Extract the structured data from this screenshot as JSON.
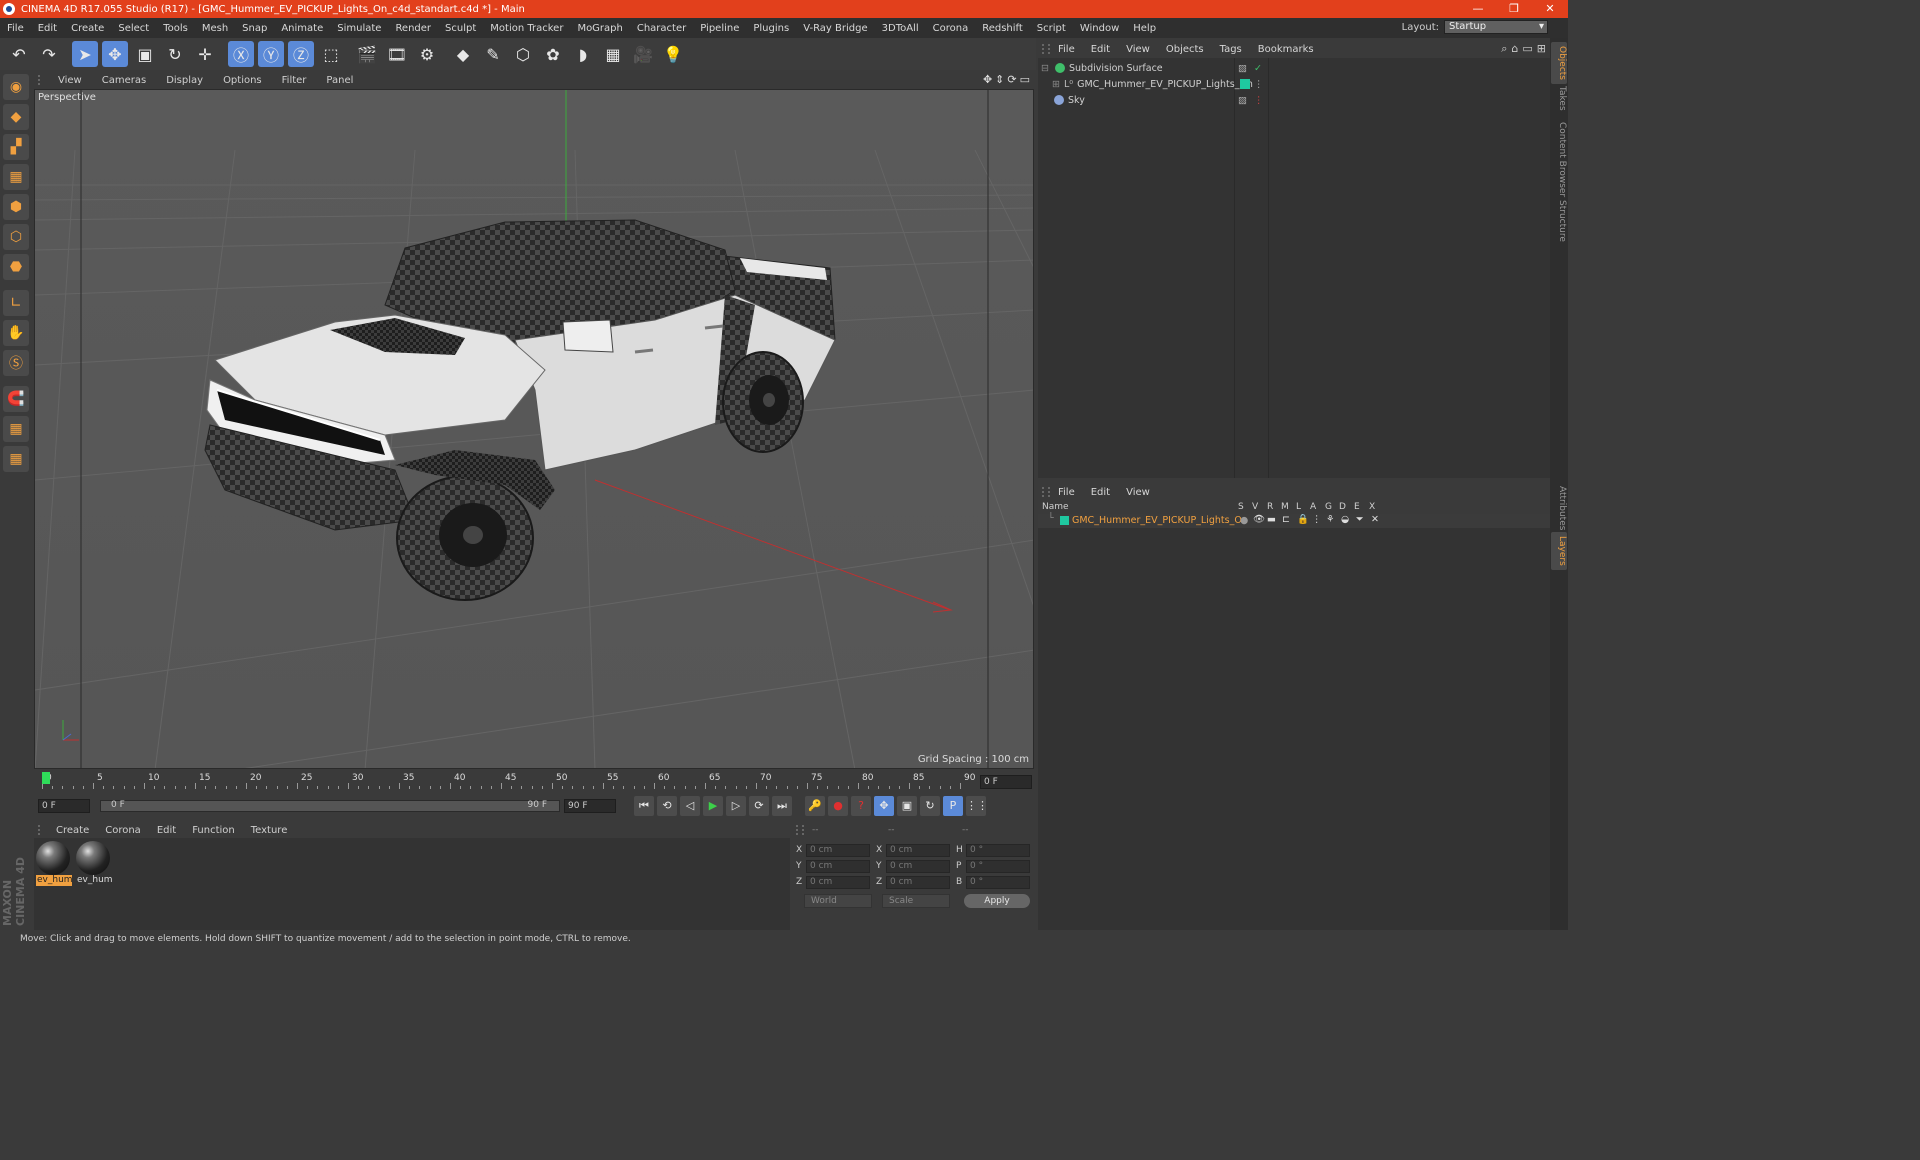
{
  "window": {
    "title": "CINEMA 4D R17.055 Studio (R17) - [GMC_Hummer_EV_PICKUP_Lights_On_c4d_standart.c4d *] - Main",
    "controls": [
      "—",
      "❐",
      "✕"
    ]
  },
  "menubar": {
    "items": [
      "File",
      "Edit",
      "Create",
      "Select",
      "Tools",
      "Mesh",
      "Snap",
      "Animate",
      "Simulate",
      "Render",
      "Sculpt",
      "Motion Tracker",
      "MoGraph",
      "Character",
      "Pipeline",
      "Plugins",
      "V-Ray Bridge",
      "3DToAll",
      "Corona",
      "Redshift",
      "Script",
      "Window",
      "Help"
    ],
    "layout_label": "Layout:",
    "layout_value": "Startup"
  },
  "toolbar": {
    "buttons": [
      {
        "name": "undo-icon",
        "glyph": "↶"
      },
      {
        "name": "redo-icon",
        "glyph": "↷"
      },
      {
        "name": "live-select-icon",
        "glyph": "➤",
        "selected": true
      },
      {
        "name": "move-icon",
        "glyph": "✥",
        "selected": true
      },
      {
        "name": "scale-icon",
        "glyph": "▣"
      },
      {
        "name": "rotate-icon",
        "glyph": "↻"
      },
      {
        "name": "transform-icon",
        "glyph": "✛"
      },
      {
        "name": "x-axis-icon",
        "glyph": "Ⓧ",
        "selected": true
      },
      {
        "name": "y-axis-icon",
        "glyph": "Ⓨ",
        "selected": true
      },
      {
        "name": "z-axis-icon",
        "glyph": "Ⓩ",
        "selected": true
      },
      {
        "name": "world-coord-icon",
        "glyph": "⬚"
      },
      {
        "name": "render-view-icon",
        "glyph": "🎬"
      },
      {
        "name": "render-picture-viewer-icon",
        "glyph": "🎞"
      },
      {
        "name": "render-settings-icon",
        "glyph": "⚙"
      },
      {
        "name": "cube-icon",
        "glyph": "◆"
      },
      {
        "name": "pen-spline-icon",
        "glyph": "✎"
      },
      {
        "name": "subdivision-icon",
        "glyph": "⬡"
      },
      {
        "name": "mograph-cloner-icon",
        "glyph": "✿"
      },
      {
        "name": "deformer-icon",
        "glyph": "◗"
      },
      {
        "name": "floor-icon",
        "glyph": "▦"
      },
      {
        "name": "camera-icon",
        "glyph": "🎥"
      },
      {
        "name": "light-icon",
        "glyph": "💡"
      }
    ]
  },
  "lefttools": {
    "buttons": [
      "make-editable-icon",
      "model-mode-icon",
      "texture-mode-icon",
      "workplane-icon",
      "points-mode-icon",
      "edges-mode-icon",
      "polygons-mode-icon",
      "axis-mode-icon",
      "tweak-mode-icon",
      "solo-icon",
      "magnet-icon",
      "snap-grid-icon",
      "snap-settings-icon"
    ],
    "glyphs": [
      "◉",
      "◆",
      "▞",
      "▦",
      "⬢",
      "⬡",
      "⬣",
      "∟",
      "✋",
      "Ⓢ",
      "🧲",
      "▦",
      "▦"
    ]
  },
  "branding": "MAXON CINEMA 4D",
  "viewport": {
    "menu": [
      "View",
      "Cameras",
      "Display",
      "Options",
      "Filter",
      "Panel"
    ],
    "camera_label": "Perspective",
    "grid_spacing": "Grid Spacing : 100 cm",
    "nav_icons": [
      "✥",
      "⇕",
      "⟳",
      "▭"
    ]
  },
  "timeline": {
    "ticks": [
      "0",
      "5",
      "10",
      "15",
      "20",
      "25",
      "30",
      "35",
      "40",
      "45",
      "50",
      "55",
      "60",
      "65",
      "70",
      "75",
      "80",
      "85",
      "90"
    ],
    "current_frame": "0 F",
    "start_field": "0 F",
    "range_start": "0 F",
    "range_end": "90 F",
    "end_field": "90 F"
  },
  "transport": {
    "buttons": [
      "⏮",
      "⟲",
      "◁",
      "▶",
      "▷",
      "⟳",
      "⏭"
    ],
    "extra": [
      "🔑",
      "●",
      "?",
      "✥",
      "▣",
      "↻",
      "P",
      "⋮⋮"
    ]
  },
  "material_manager": {
    "menu": [
      "Create",
      "Corona",
      "Edit",
      "Function",
      "Texture"
    ],
    "materials": [
      {
        "label": "ev_humr",
        "selected": true
      },
      {
        "label": "ev_humr",
        "selected": false
      }
    ]
  },
  "coordinates": {
    "headers": [
      "--",
      "--",
      "--"
    ],
    "rows": [
      {
        "l1": "X",
        "v1": "0 cm",
        "l2": "X",
        "v2": "0 cm",
        "l3": "H",
        "v3": "0 °"
      },
      {
        "l1": "Y",
        "v1": "0 cm",
        "l2": "Y",
        "v2": "0 cm",
        "l3": "P",
        "v3": "0 °"
      },
      {
        "l1": "Z",
        "v1": "0 cm",
        "l2": "Z",
        "v2": "0 cm",
        "l3": "B",
        "v3": "0 °"
      }
    ],
    "world_dropdown": "World",
    "scale_dropdown": "Scale",
    "apply_label": "Apply"
  },
  "object_manager": {
    "menu": [
      "File",
      "Edit",
      "View",
      "Objects",
      "Tags",
      "Bookmarks"
    ],
    "objects": [
      {
        "name": "Subdivision Surface",
        "icon_color": "#3fbf6a"
      },
      {
        "name": "GMC_Hummer_EV_PICKUP_Lights_On",
        "icon_color": "#b0b0b0",
        "tag_color": "#1fc8a0"
      },
      {
        "name": "Sky",
        "icon_color": "#8aa4d8"
      }
    ]
  },
  "layer_manager": {
    "menu": [
      "File",
      "Edit",
      "View"
    ],
    "columns": [
      "Name",
      "S",
      "V",
      "R",
      "M",
      "L",
      "A",
      "G",
      "D",
      "E",
      "X"
    ],
    "layers": [
      {
        "name": "GMC_Hummer_EV_PICKUP_Lights_On",
        "color": "#1fc8a0"
      }
    ]
  },
  "side_tabs": [
    "Objects",
    "Takes",
    "Content Browser",
    "Structure",
    "Attributes",
    "Layers"
  ],
  "status": "Move: Click and drag to move elements. Hold down SHIFT to quantize movement / add to the selection in point mode, CTRL to remove.",
  "colors": {
    "titlebar": "#e2401c",
    "accent_orange": "#f0a040",
    "selection_blue": "#5b8ad8",
    "layer_teal": "#1fc8a0"
  }
}
